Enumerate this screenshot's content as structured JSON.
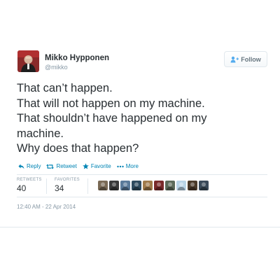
{
  "user": {
    "display_name": "Mikko Hypponen",
    "handle": "@mikko",
    "avatar_icon": "profile-photo-icon"
  },
  "follow_button": {
    "label": "Follow",
    "icon": "add-user-icon",
    "color": "#66757f"
  },
  "tweet": {
    "lines": [
      "That can’t happen.",
      "That will not happen on my machine.",
      "That shouldn’t have happened on my",
      "machine.",
      "Why does that happen?"
    ]
  },
  "actions": {
    "reply": "Reply",
    "retweet": "Retweet",
    "favorite": "Favorite",
    "more": "More",
    "color": "#0084b4"
  },
  "stats": {
    "retweets_label": "RETWEETS",
    "retweets_count": "40",
    "favorites_label": "FAVORITES",
    "favorites_count": "34"
  },
  "favoriters": [
    {
      "icon": "face-icon",
      "color": "#7a6a55"
    },
    {
      "icon": "face-icon",
      "color": "#3a3a3a"
    },
    {
      "icon": "face-icon",
      "color": "#5a7a9a"
    },
    {
      "icon": "face-icon",
      "color": "#2e4a5e"
    },
    {
      "icon": "face-icon",
      "color": "#a07a4a"
    },
    {
      "icon": "face-icon",
      "color": "#7a2a2a"
    },
    {
      "icon": "face-icon",
      "color": "#5c6b5a"
    },
    {
      "icon": "face-icon",
      "color": "#b8d4e6"
    },
    {
      "icon": "face-icon",
      "color": "#4a3a2a"
    },
    {
      "icon": "face-icon",
      "color": "#3a4a5a"
    }
  ],
  "timestamp": "12:40 AM - 22 Apr 2014"
}
